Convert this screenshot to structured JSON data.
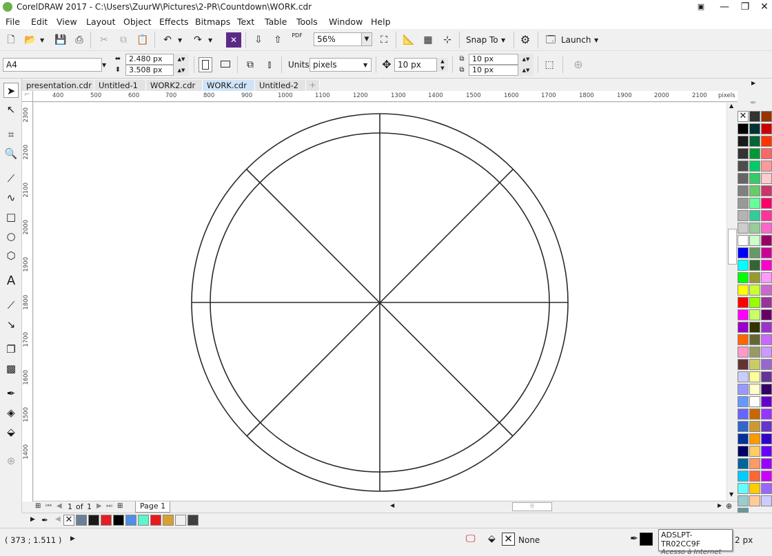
{
  "window": {
    "title": "CorelDRAW 2017 - C:\\Users\\ZuurW\\Pictures\\2-PR\\Countdown\\WORK.cdr",
    "minimize": "—",
    "restore": "❐",
    "close": "✕"
  },
  "menu": {
    "items": [
      "File",
      "Edit",
      "View",
      "Layout",
      "Object",
      "Effects",
      "Bitmaps",
      "Text",
      "Table",
      "Tools",
      "Window",
      "Help"
    ]
  },
  "toolbar": {
    "zoom": "56%",
    "snap_to": "Snap To",
    "launch": "Launch",
    "pdf": "PDF"
  },
  "property_bar": {
    "page_size": "A4",
    "width": "2.480 px",
    "height": "3.508 px",
    "units_label": "Units:",
    "units_value": "pixels",
    "nudge": "10 px",
    "dup_x": "10 px",
    "dup_y": "10 px"
  },
  "doc_tabs": [
    "presentation.cdr",
    "Untitled-1",
    "WORK2.cdr",
    "WORK.cdr",
    "Untitled-2"
  ],
  "active_tab": "WORK.cdr",
  "rulers": {
    "h_unit": "pixels",
    "h_ticks": [
      "400",
      "500",
      "600",
      "700",
      "800",
      "900",
      "1000",
      "1100",
      "1200",
      "1300",
      "1400",
      "1500",
      "1600",
      "1700",
      "1800",
      "1900",
      "2000",
      "2100"
    ],
    "v_ticks": [
      "2300",
      "2200",
      "2100",
      "2000",
      "1900",
      "1800",
      "1700",
      "1600",
      "1500",
      "1400"
    ]
  },
  "page_nav": {
    "current": "1",
    "of": "of",
    "total": "1",
    "page_tab": "Page 1"
  },
  "status": {
    "coords": "( 373  ; 1.511  )",
    "fill": "None",
    "outline": "2 px"
  },
  "tooltip": {
    "line1": "ADSLPT-TR02CC9F",
    "line2": "Acesso à Internet"
  },
  "colors": {
    "doc_palette": [
      "#6b7f99",
      "#1a1a1a",
      "#e31e24",
      "#000000",
      "#4f8fe6",
      "#5ff5c8",
      "#e81a1a",
      "#d8a030",
      "#f0f0f0",
      "#404040"
    ],
    "palette_col1": [
      "#000000",
      "#1a1a1a",
      "#333333",
      "#4d4d4d",
      "#666666",
      "#808080",
      "#999999",
      "#b3b3b3",
      "#cccccc",
      "#ffffff",
      "#0000ff",
      "#00ffff",
      "#00ff00",
      "#ffff00",
      "#ff0000",
      "#ff00ff",
      "#9900cc",
      "#ff6600",
      "#ff99cc",
      "#663333",
      "#ccccff",
      "#9999ff",
      "#6699ff",
      "#6666ff",
      "#3366cc",
      "#003399",
      "#000066",
      "#006699",
      "#00ccff",
      "#66ffff",
      "#99cccc",
      "#669999"
    ],
    "palette_col2": [
      "#333333",
      "#003333",
      "#006633",
      "#009933",
      "#00cc66",
      "#33cc66",
      "#66cc66",
      "#66ff99",
      "#33cc99",
      "#99cc99",
      "#ccffcc",
      "#669966",
      "#336633",
      "#999933",
      "#ccff33",
      "#99ff00",
      "#ccff66",
      "#333300",
      "#666633",
      "#999966",
      "#cccc66",
      "#ffff99",
      "#ffffcc",
      "#ffffff",
      "#cc6600",
      "#cc9933",
      "#ff9900",
      "#ffcc66",
      "#ff9966",
      "#ff6633",
      "#ffcc00",
      "#ffcc99"
    ],
    "palette_col3": [
      "#993300",
      "#cc0000",
      "#ff3300",
      "#ff6666",
      "#ff9999",
      "#ffcccc",
      "#cc3366",
      "#ff0066",
      "#ff3399",
      "#ff66cc",
      "#990066",
      "#cc0099",
      "#ff00cc",
      "#ff99ff",
      "#cc66cc",
      "#993399",
      "#660066",
      "#9933cc",
      "#cc66ff",
      "#cc99ff",
      "#9966cc",
      "#663399",
      "#330066",
      "#6600cc",
      "#9933ff",
      "#6633cc",
      "#3300cc",
      "#6600ff",
      "#9900ff",
      "#cc00ff",
      "#9966ff",
      "#ccccff"
    ]
  }
}
